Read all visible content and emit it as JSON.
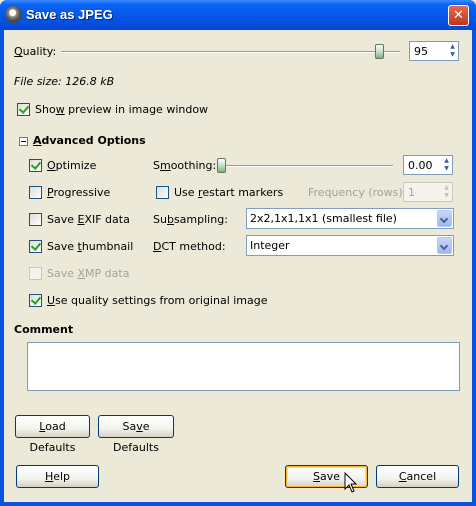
{
  "window": {
    "title": "Save as JPEG",
    "close_glyph": "✕"
  },
  "quality": {
    "label": "Quality:",
    "value": "95",
    "level_percent": 95
  },
  "file_size": "File size: 126.8 kB",
  "show_preview": {
    "label": "Show preview in image window",
    "checked": true
  },
  "advanced": {
    "title": "Advanced Options",
    "optimize": {
      "label": "Optimize",
      "checked": true
    },
    "progressive": {
      "label": "Progressive",
      "checked": false
    },
    "save_exif": {
      "label": "Save EXIF data",
      "checked": false
    },
    "save_thumbnail": {
      "label": "Save thumbnail",
      "checked": true
    },
    "save_xmp": {
      "label": "Save XMP data",
      "checked": false,
      "disabled": true
    },
    "use_quality": {
      "label": "Use quality settings from original image",
      "checked": true
    },
    "smoothing": {
      "label": "Smoothing:",
      "value": "0.00",
      "level_percent": 0
    },
    "restart_markers": {
      "label": "Use restart markers",
      "checked": false
    },
    "frequency": {
      "label": "Frequency (rows):",
      "value": "1",
      "disabled": true
    },
    "subsampling": {
      "label": "Subsampling:",
      "value": "2x2,1x1,1x1 (smallest file)"
    },
    "dct_method": {
      "label": "DCT method:",
      "value": "Integer"
    }
  },
  "comment": {
    "label": "Comment",
    "value": ""
  },
  "buttons": {
    "load_defaults": "Load Defaults",
    "save_defaults": "Save Defaults",
    "help": "Help",
    "save": "Save",
    "cancel": "Cancel"
  },
  "icons": {
    "app": "gimp-icon",
    "close": "close-icon",
    "cursor": "mouse-pointer-icon"
  }
}
